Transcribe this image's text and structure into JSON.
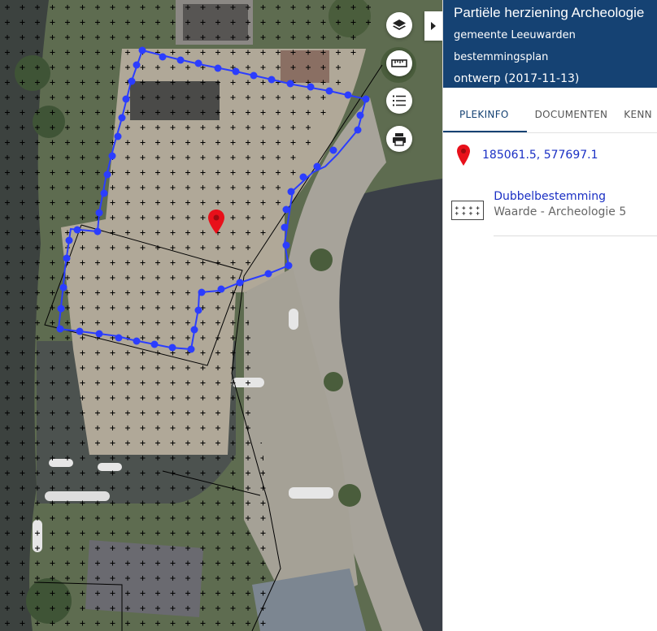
{
  "map": {
    "layer_selector_icon": "layers-icon",
    "measure_tool_icon": "ruler-icon",
    "legend_icon": "list-icon",
    "print_icon": "printer-icon",
    "collapse_panel_icon": "chevron-right-icon",
    "marker_icon": "map-pin-icon",
    "colors": {
      "plan_boundary": "#2b3dff",
      "marker": "#e8101a"
    }
  },
  "panel": {
    "title": "Partiële herziening Archeologie",
    "municipality": "gemeente Leeuwarden",
    "plan_type": "bestemmingsplan",
    "status": "ontwerp (2017-11-13)",
    "header_color": "#154273",
    "tabs": [
      {
        "label": "PLEKINFO",
        "active": true
      },
      {
        "label": "DOCUMENTEN",
        "active": false
      },
      {
        "label": "KENN",
        "active": false
      }
    ],
    "location": {
      "icon": "map-pin-icon",
      "coordinates": "185061.5, 577697.1"
    },
    "layers": [
      {
        "icon": "crosshatch-legend-icon",
        "name": "Dubbelbestemming",
        "description": "Waarde - Archeologie 5"
      }
    ]
  }
}
